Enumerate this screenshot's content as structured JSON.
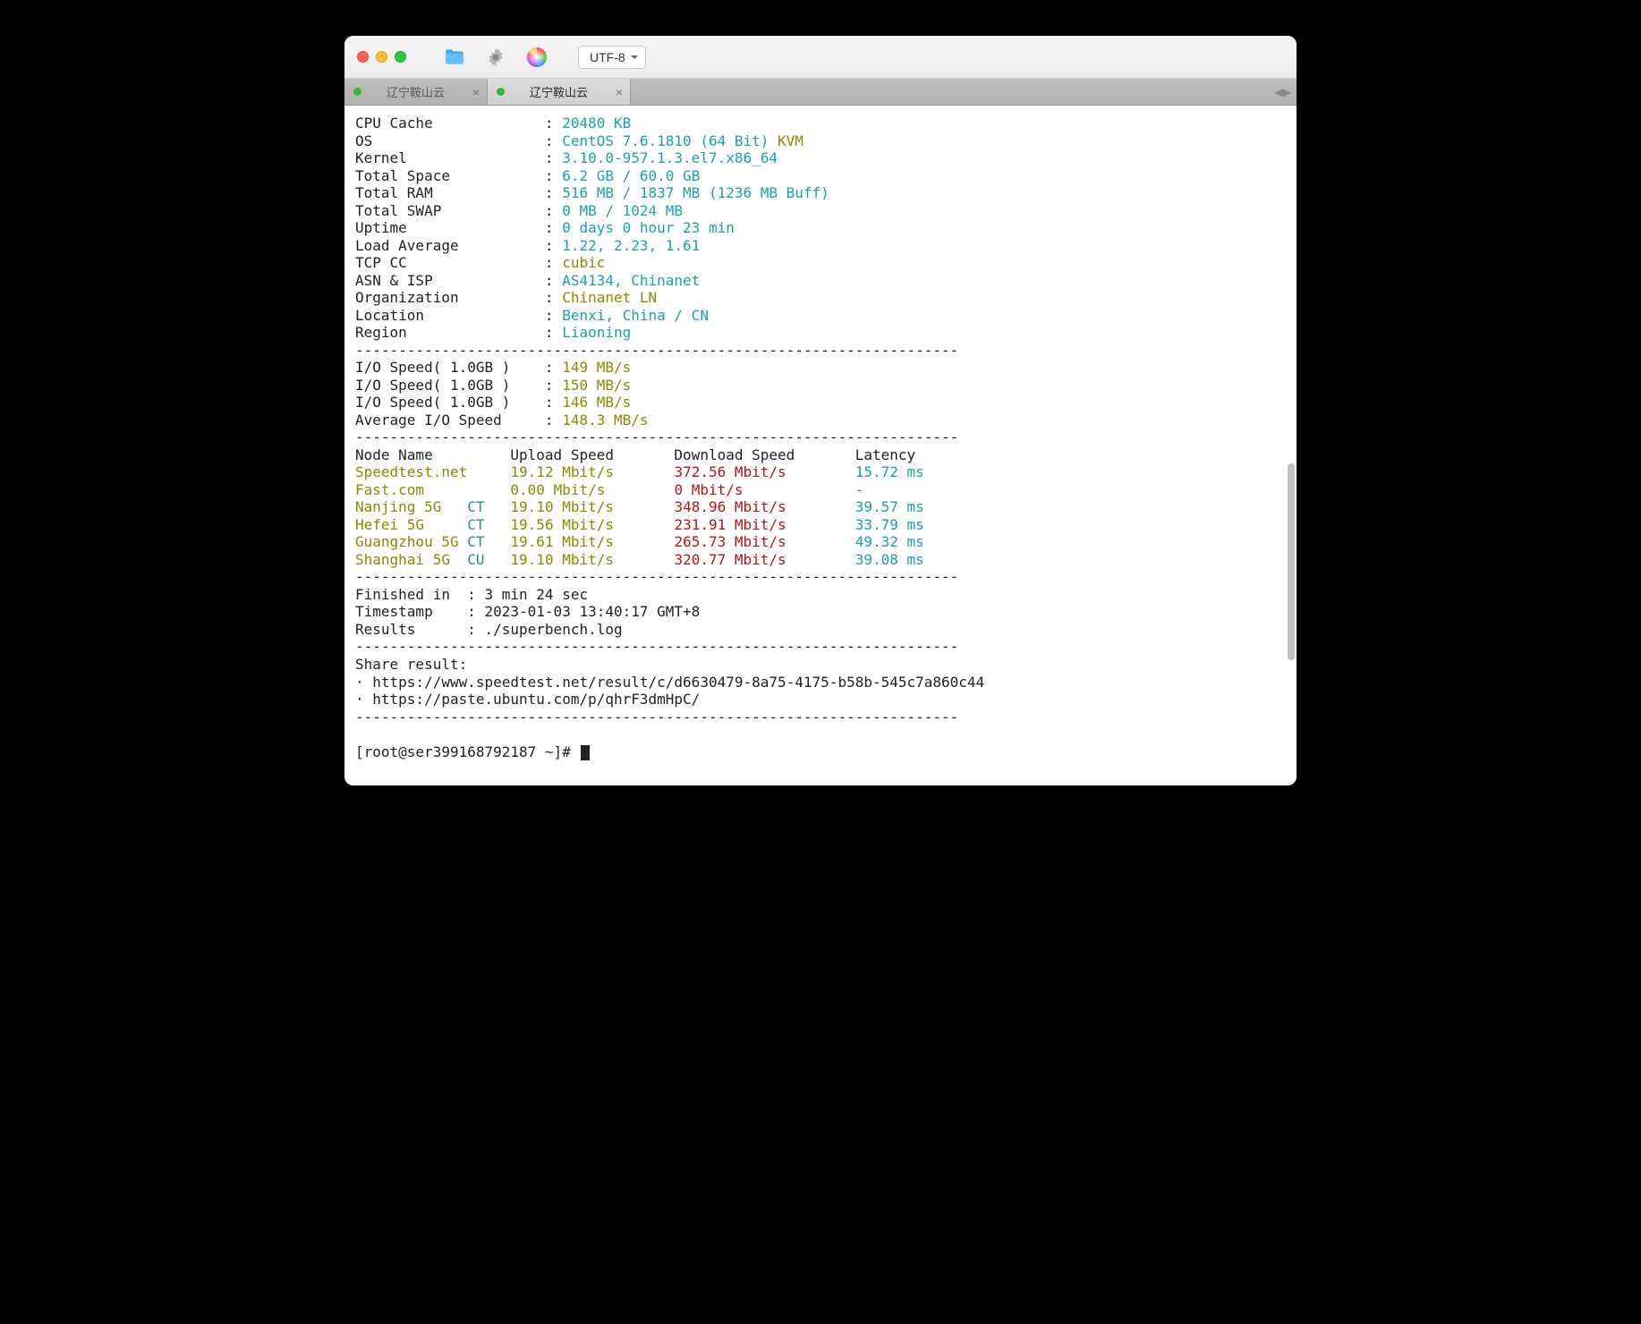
{
  "toolbar": {
    "encoding": "UTF-8"
  },
  "tabs": [
    {
      "label": "辽宁鞍山云",
      "active": false
    },
    {
      "label": "辽宁鞍山云",
      "active": true
    }
  ],
  "divider": "----------------------------------------------------------------------",
  "sysinfo": [
    {
      "label": "CPU Cache",
      "value": "20480 KB",
      "color": "cyan"
    },
    {
      "label": "OS",
      "value": "CentOS 7.6.1810 (64 Bit)",
      "color": "cyan",
      "suffix": " KVM",
      "suffix_color": "olive"
    },
    {
      "label": "Kernel",
      "value": "3.10.0-957.1.3.el7.x86_64",
      "color": "cyan"
    },
    {
      "label": "Total Space",
      "value": "6.2 GB / 60.0 GB",
      "color": "cyan"
    },
    {
      "label": "Total RAM",
      "value": "516 MB / 1837 MB (1236 MB Buff)",
      "color": "cyan"
    },
    {
      "label": "Total SWAP",
      "value": "0 MB / 1024 MB",
      "color": "cyan"
    },
    {
      "label": "Uptime",
      "value": "0 days 0 hour 23 min",
      "color": "cyan"
    },
    {
      "label": "Load Average",
      "value": "1.22, 2.23, 1.61",
      "color": "cyan"
    },
    {
      "label": "TCP CC",
      "value": "cubic",
      "color": "olive"
    },
    {
      "label": "ASN & ISP",
      "value": "AS4134, Chinanet",
      "color": "cyan"
    },
    {
      "label": "Organization",
      "value": "Chinanet LN",
      "color": "olive"
    },
    {
      "label": "Location",
      "value": "Benxi, China / CN",
      "color": "cyan"
    },
    {
      "label": "Region",
      "value": "Liaoning",
      "color": "cyan"
    }
  ],
  "io": [
    {
      "label": "I/O Speed( 1.0GB )",
      "value": "149 MB/s"
    },
    {
      "label": "I/O Speed( 1.0GB )",
      "value": "150 MB/s"
    },
    {
      "label": "I/O Speed( 1.0GB )",
      "value": "146 MB/s"
    },
    {
      "label": "Average I/O Speed",
      "value": "148.3 MB/s"
    }
  ],
  "speed_header": {
    "node": "Node Name",
    "up": "Upload Speed",
    "down": "Download Speed",
    "lat": "Latency"
  },
  "speed": [
    {
      "node": "Speedtest.net",
      "isp": "",
      "up": "19.12 Mbit/s",
      "down": "372.56 Mbit/s",
      "lat": "15.72 ms"
    },
    {
      "node": "Fast.com",
      "isp": "",
      "up": "0.00 Mbit/s",
      "down": "0 Mbit/s",
      "lat": "-"
    },
    {
      "node": "Nanjing 5G",
      "isp": "CT",
      "up": "19.10 Mbit/s",
      "down": "348.96 Mbit/s",
      "lat": "39.57 ms"
    },
    {
      "node": "Hefei 5G",
      "isp": "CT",
      "up": "19.56 Mbit/s",
      "down": "231.91 Mbit/s",
      "lat": "33.79 ms"
    },
    {
      "node": "Guangzhou 5G",
      "isp": "CT",
      "up": "19.61 Mbit/s",
      "down": "265.73 Mbit/s",
      "lat": "49.32 ms"
    },
    {
      "node": "Shanghai 5G",
      "isp": "CU",
      "up": "19.10 Mbit/s",
      "down": "320.77 Mbit/s",
      "lat": "39.08 ms"
    }
  ],
  "finish": {
    "finished_label": "Finished in",
    "finished": "3 min 24 sec",
    "timestamp_label": "Timestamp",
    "timestamp": "2023-01-03 13:40:17 GMT+8",
    "results_label": "Results",
    "results": "./superbench.log"
  },
  "share": {
    "label": "Share result:",
    "url1": "https://www.speedtest.net/result/c/d6630479-8a75-4175-b58b-545c7a860c44",
    "url2": "https://paste.ubuntu.com/p/qhrF3dmHpC/"
  },
  "prompt": "[root@ser399168792187 ~]# "
}
